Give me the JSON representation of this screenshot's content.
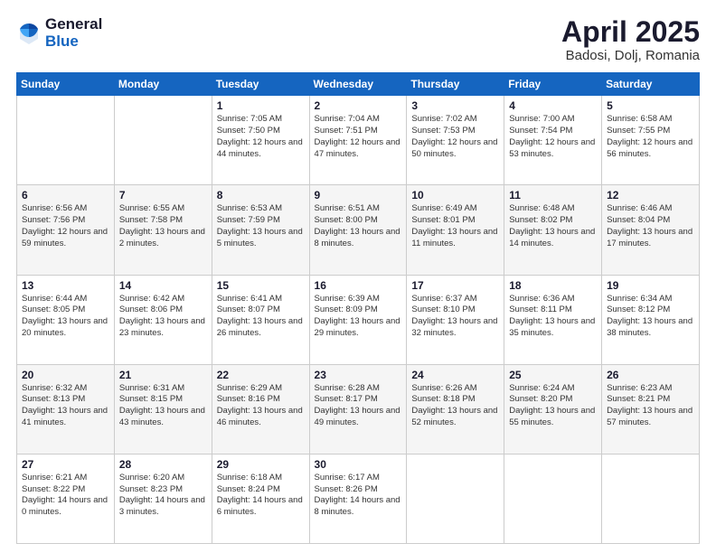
{
  "header": {
    "logo_general": "General",
    "logo_blue": "Blue",
    "month_title": "April 2025",
    "location": "Badosi, Dolj, Romania"
  },
  "days_of_week": [
    "Sunday",
    "Monday",
    "Tuesday",
    "Wednesday",
    "Thursday",
    "Friday",
    "Saturday"
  ],
  "weeks": [
    [
      {
        "day": "",
        "info": ""
      },
      {
        "day": "",
        "info": ""
      },
      {
        "day": "1",
        "info": "Sunrise: 7:05 AM\nSunset: 7:50 PM\nDaylight: 12 hours and 44 minutes."
      },
      {
        "day": "2",
        "info": "Sunrise: 7:04 AM\nSunset: 7:51 PM\nDaylight: 12 hours and 47 minutes."
      },
      {
        "day": "3",
        "info": "Sunrise: 7:02 AM\nSunset: 7:53 PM\nDaylight: 12 hours and 50 minutes."
      },
      {
        "day": "4",
        "info": "Sunrise: 7:00 AM\nSunset: 7:54 PM\nDaylight: 12 hours and 53 minutes."
      },
      {
        "day": "5",
        "info": "Sunrise: 6:58 AM\nSunset: 7:55 PM\nDaylight: 12 hours and 56 minutes."
      }
    ],
    [
      {
        "day": "6",
        "info": "Sunrise: 6:56 AM\nSunset: 7:56 PM\nDaylight: 12 hours and 59 minutes."
      },
      {
        "day": "7",
        "info": "Sunrise: 6:55 AM\nSunset: 7:58 PM\nDaylight: 13 hours and 2 minutes."
      },
      {
        "day": "8",
        "info": "Sunrise: 6:53 AM\nSunset: 7:59 PM\nDaylight: 13 hours and 5 minutes."
      },
      {
        "day": "9",
        "info": "Sunrise: 6:51 AM\nSunset: 8:00 PM\nDaylight: 13 hours and 8 minutes."
      },
      {
        "day": "10",
        "info": "Sunrise: 6:49 AM\nSunset: 8:01 PM\nDaylight: 13 hours and 11 minutes."
      },
      {
        "day": "11",
        "info": "Sunrise: 6:48 AM\nSunset: 8:02 PM\nDaylight: 13 hours and 14 minutes."
      },
      {
        "day": "12",
        "info": "Sunrise: 6:46 AM\nSunset: 8:04 PM\nDaylight: 13 hours and 17 minutes."
      }
    ],
    [
      {
        "day": "13",
        "info": "Sunrise: 6:44 AM\nSunset: 8:05 PM\nDaylight: 13 hours and 20 minutes."
      },
      {
        "day": "14",
        "info": "Sunrise: 6:42 AM\nSunset: 8:06 PM\nDaylight: 13 hours and 23 minutes."
      },
      {
        "day": "15",
        "info": "Sunrise: 6:41 AM\nSunset: 8:07 PM\nDaylight: 13 hours and 26 minutes."
      },
      {
        "day": "16",
        "info": "Sunrise: 6:39 AM\nSunset: 8:09 PM\nDaylight: 13 hours and 29 minutes."
      },
      {
        "day": "17",
        "info": "Sunrise: 6:37 AM\nSunset: 8:10 PM\nDaylight: 13 hours and 32 minutes."
      },
      {
        "day": "18",
        "info": "Sunrise: 6:36 AM\nSunset: 8:11 PM\nDaylight: 13 hours and 35 minutes."
      },
      {
        "day": "19",
        "info": "Sunrise: 6:34 AM\nSunset: 8:12 PM\nDaylight: 13 hours and 38 minutes."
      }
    ],
    [
      {
        "day": "20",
        "info": "Sunrise: 6:32 AM\nSunset: 8:13 PM\nDaylight: 13 hours and 41 minutes."
      },
      {
        "day": "21",
        "info": "Sunrise: 6:31 AM\nSunset: 8:15 PM\nDaylight: 13 hours and 43 minutes."
      },
      {
        "day": "22",
        "info": "Sunrise: 6:29 AM\nSunset: 8:16 PM\nDaylight: 13 hours and 46 minutes."
      },
      {
        "day": "23",
        "info": "Sunrise: 6:28 AM\nSunset: 8:17 PM\nDaylight: 13 hours and 49 minutes."
      },
      {
        "day": "24",
        "info": "Sunrise: 6:26 AM\nSunset: 8:18 PM\nDaylight: 13 hours and 52 minutes."
      },
      {
        "day": "25",
        "info": "Sunrise: 6:24 AM\nSunset: 8:20 PM\nDaylight: 13 hours and 55 minutes."
      },
      {
        "day": "26",
        "info": "Sunrise: 6:23 AM\nSunset: 8:21 PM\nDaylight: 13 hours and 57 minutes."
      }
    ],
    [
      {
        "day": "27",
        "info": "Sunrise: 6:21 AM\nSunset: 8:22 PM\nDaylight: 14 hours and 0 minutes."
      },
      {
        "day": "28",
        "info": "Sunrise: 6:20 AM\nSunset: 8:23 PM\nDaylight: 14 hours and 3 minutes."
      },
      {
        "day": "29",
        "info": "Sunrise: 6:18 AM\nSunset: 8:24 PM\nDaylight: 14 hours and 6 minutes."
      },
      {
        "day": "30",
        "info": "Sunrise: 6:17 AM\nSunset: 8:26 PM\nDaylight: 14 hours and 8 minutes."
      },
      {
        "day": "",
        "info": ""
      },
      {
        "day": "",
        "info": ""
      },
      {
        "day": "",
        "info": ""
      }
    ]
  ]
}
